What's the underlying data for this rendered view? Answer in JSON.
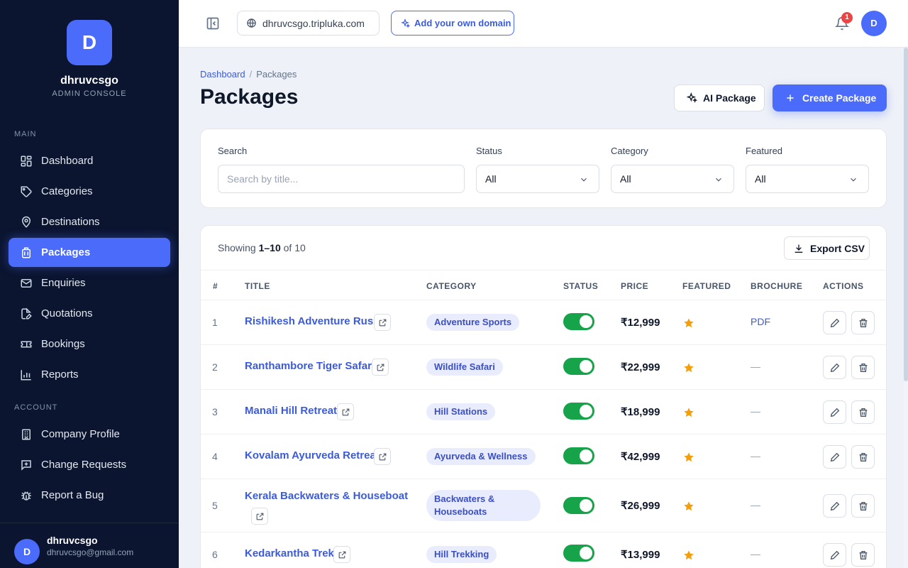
{
  "brand": {
    "initial": "D",
    "name": "dhruvcsgo",
    "subtitle": "ADMIN CONSOLE"
  },
  "sidebar": {
    "main_label": "MAIN",
    "account_label": "ACCOUNT",
    "items": [
      {
        "label": "Dashboard",
        "icon": "dashboard-icon"
      },
      {
        "label": "Categories",
        "icon": "tag-icon"
      },
      {
        "label": "Destinations",
        "icon": "map-pin-icon"
      },
      {
        "label": "Packages",
        "icon": "luggage-icon",
        "active": true
      },
      {
        "label": "Enquiries",
        "icon": "mail-icon"
      },
      {
        "label": "Quotations",
        "icon": "file-edit-icon"
      },
      {
        "label": "Bookings",
        "icon": "ticket-icon"
      },
      {
        "label": "Reports",
        "icon": "bar-chart-icon"
      }
    ],
    "account_items": [
      {
        "label": "Company Profile",
        "icon": "building-icon"
      },
      {
        "label": "Change Requests",
        "icon": "message-plus-icon"
      },
      {
        "label": "Report a Bug",
        "icon": "bug-icon"
      }
    ],
    "user": {
      "initial": "D",
      "name": "dhruvcsgo",
      "email": "dhruvcsgo@gmail.com"
    }
  },
  "header": {
    "domain": "dhruvcsgo.tripluka.com",
    "add_domain_label": "Add your own domain",
    "notification_count": "1",
    "avatar_initial": "D"
  },
  "page": {
    "breadcrumb_root": "Dashboard",
    "breadcrumb_sep": "/",
    "breadcrumb_current": "Packages",
    "title": "Packages",
    "ai_button": "AI Package",
    "create_button": "Create Package"
  },
  "filters": {
    "search_label": "Search",
    "search_placeholder": "Search by title...",
    "status_label": "Status",
    "status_value": "All",
    "category_label": "Category",
    "category_value": "All",
    "featured_label": "Featured",
    "featured_value": "All"
  },
  "table": {
    "showing_prefix": "Showing",
    "showing_range": "1–10",
    "showing_suffix": "of 10",
    "export_label": "Export CSV",
    "columns": [
      "#",
      "TITLE",
      "CATEGORY",
      "STATUS",
      "PRICE",
      "FEATURED",
      "BROCHURE",
      "ACTIONS"
    ],
    "rows": [
      {
        "num": "1",
        "title": "Rishikesh Adventure Rush",
        "category": "Adventure Sports",
        "status": "on",
        "price": "₹12,999",
        "featured": true,
        "brochure": "PDF"
      },
      {
        "num": "2",
        "title": "Ranthambore Tiger Safari",
        "category": "Wildlife Safari",
        "status": "on",
        "price": "₹22,999",
        "featured": true,
        "brochure": "—"
      },
      {
        "num": "3",
        "title": "Manali Hill Retreat",
        "category": "Hill Stations",
        "status": "on",
        "price": "₹18,999",
        "featured": true,
        "brochure": "—"
      },
      {
        "num": "4",
        "title": "Kovalam Ayurveda Retreat",
        "category": "Ayurveda & Wellness",
        "status": "on",
        "price": "₹42,999",
        "featured": true,
        "brochure": "—"
      },
      {
        "num": "5",
        "title": "Kerala Backwaters & Houseboat",
        "category": "Backwaters & Houseboats",
        "status": "on",
        "price": "₹26,999",
        "featured": true,
        "brochure": "—"
      },
      {
        "num": "6",
        "title": "Kedarkantha Trek",
        "category": "Hill Trekking",
        "status": "on",
        "price": "₹13,999",
        "featured": true,
        "brochure": "—"
      }
    ]
  },
  "colors": {
    "accent": "#4b6bfb",
    "sidebar_bg": "#0b1530",
    "toggle_on": "#16a34a",
    "star": "#f59e0b"
  }
}
